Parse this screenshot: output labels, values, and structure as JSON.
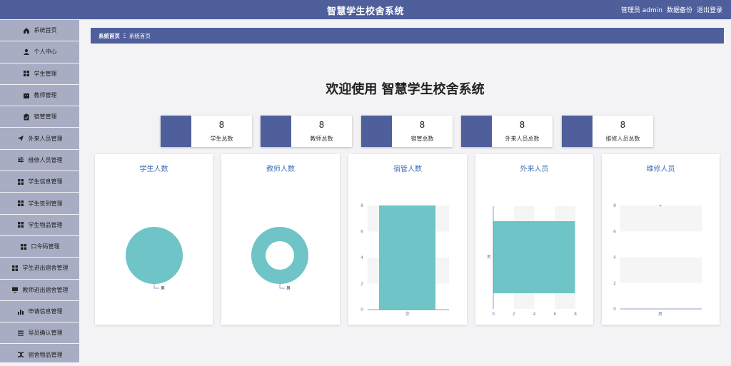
{
  "header": {
    "title": "智慧学生校舍系统",
    "admin": "管理员 admin",
    "backup": "数据备份",
    "logout": "退出登录"
  },
  "sidebar": {
    "items": [
      {
        "label": "系统首页",
        "icon": "home-icon"
      },
      {
        "label": "个人中心",
        "icon": "user-icon"
      },
      {
        "label": "学生管理",
        "icon": "grid-icon"
      },
      {
        "label": "教师管理",
        "icon": "building-icon"
      },
      {
        "label": "宿管管理",
        "icon": "clipboard-icon"
      },
      {
        "label": "外来人员管理",
        "icon": "send-icon"
      },
      {
        "label": "维修人员管理",
        "icon": "sliders-icon"
      },
      {
        "label": "学生信息管理",
        "icon": "grid-icon"
      },
      {
        "label": "学生签到管理",
        "icon": "grid-icon"
      },
      {
        "label": "学生物品管理",
        "icon": "grid-icon"
      },
      {
        "label": "口令码管理",
        "icon": "grid-icon"
      },
      {
        "label": "学生进出宿舍管理",
        "icon": "grid-icon"
      },
      {
        "label": "教师进出宿舍管理",
        "icon": "monitor-icon"
      },
      {
        "label": "申请信息管理",
        "icon": "bar-chart-icon"
      },
      {
        "label": "导员确认管理",
        "icon": "list-icon"
      },
      {
        "label": "宿舍物品管理",
        "icon": "shuffle-icon"
      }
    ]
  },
  "breadcrumb": {
    "home": "系统首页",
    "sep": "Ξ",
    "current": "系统首页"
  },
  "welcome": "欢迎使用 智慧学生校舍系统",
  "stats": [
    {
      "value": "8",
      "label": "学生总数"
    },
    {
      "value": "8",
      "label": "教师总数"
    },
    {
      "value": "8",
      "label": "宿管总数"
    },
    {
      "value": "8",
      "label": "外来人员总数"
    },
    {
      "value": "8",
      "label": "维修人员总数"
    }
  ],
  "colors": {
    "accent": "#4f5f9c",
    "chart": "#6ec4c6",
    "title": "#3f6fb5"
  },
  "chart_data": [
    {
      "type": "pie",
      "title": "学生人数",
      "categories": [
        "男"
      ],
      "values": [
        8
      ]
    },
    {
      "type": "pie",
      "title": "教师人数",
      "categories": [
        "男"
      ],
      "values": [
        8
      ],
      "donut": true
    },
    {
      "type": "bar",
      "title": "宿管人数",
      "categories": [
        "女"
      ],
      "values": [
        8
      ],
      "yticks": [
        "0",
        "2",
        "4",
        "6",
        "8"
      ],
      "ylim": [
        0,
        8
      ]
    },
    {
      "type": "bar",
      "orientation": "horizontal",
      "title": "外来人员",
      "categories": [
        "男"
      ],
      "values": [
        8
      ],
      "xticks": [
        "0",
        "2",
        "4",
        "6",
        "8"
      ],
      "xlim": [
        0,
        8
      ]
    },
    {
      "type": "line",
      "title": "维修人员",
      "categories": [
        "男"
      ],
      "values": [
        8
      ],
      "yticks": [
        "0",
        "2",
        "4",
        "6",
        "8"
      ],
      "ylim": [
        0,
        8
      ]
    }
  ]
}
